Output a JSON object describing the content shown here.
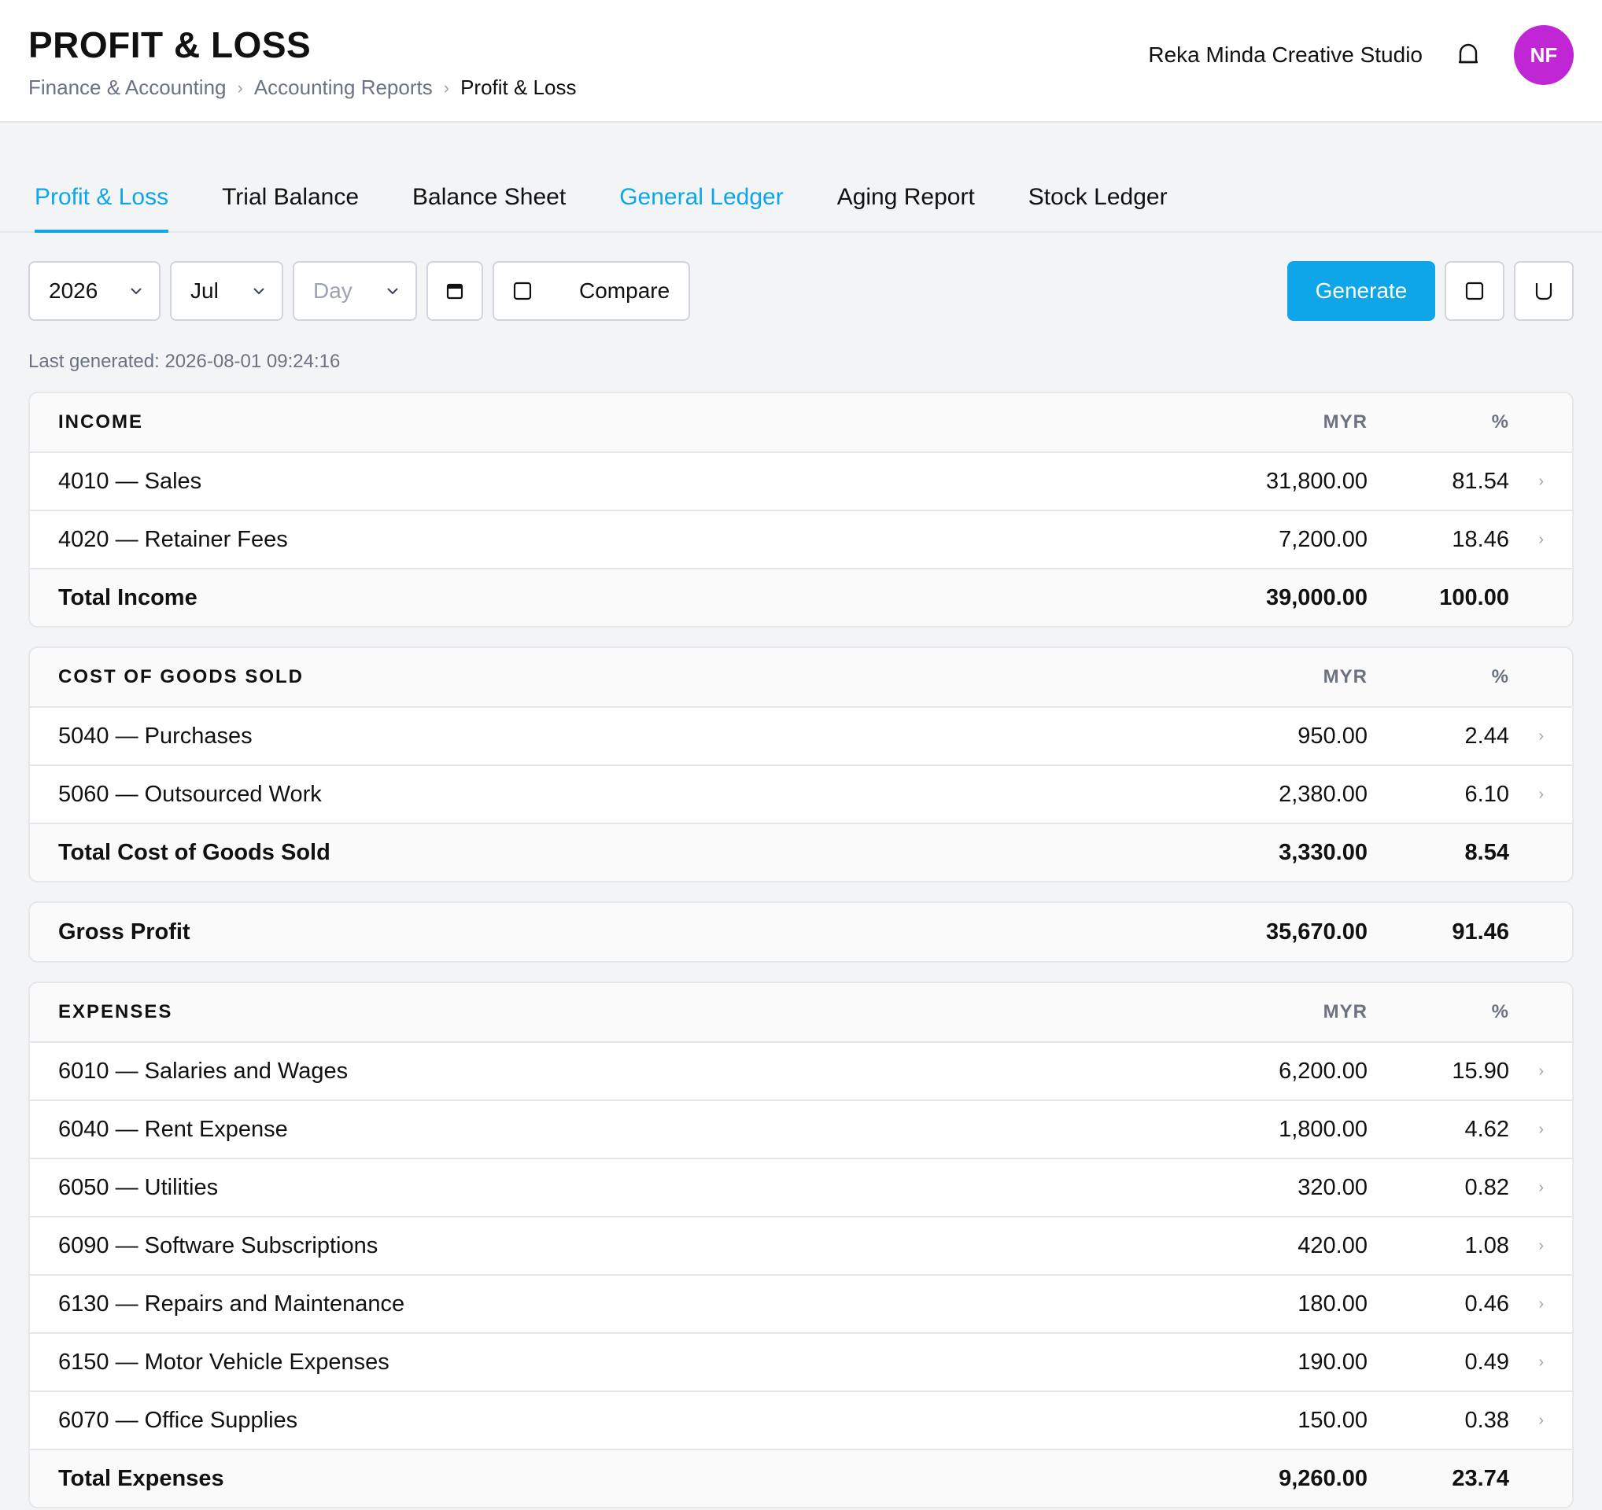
{
  "header": {
    "title": "PROFIT & LOSS",
    "breadcrumb": [
      "Finance & Accounting",
      "Accounting Reports",
      "Profit & Loss"
    ],
    "org_name": "Reka Minda Creative Studio",
    "avatar_initials": "NF",
    "bell_icon": "bell-icon"
  },
  "tabs": [
    "Profit & Loss",
    "Trial Balance",
    "Balance Sheet",
    "General Ledger",
    "Aging Report",
    "Stock Ledger"
  ],
  "toolbar": {
    "year": "2026",
    "month": "Jul",
    "day_placeholder": "Day",
    "calendar_icon": "calendar-icon",
    "compare_label": "Compare",
    "generate_label": "Generate",
    "print_icon": "print-icon",
    "download_icon": "download-icon"
  },
  "last_generated": "Last generated: 2026-08-01 09:24:16",
  "colors": {
    "accent": "#0ea5e9",
    "avatar": "#c026d3"
  },
  "income": {
    "heading": "INCOME",
    "col_amount": "MYR",
    "col_pct": "%",
    "rows": [
      {
        "name": "4010 — Sales",
        "amount": "31,800.00",
        "pct": "81.54"
      },
      {
        "name": "4020 — Retainer Fees",
        "amount": "7,200.00",
        "pct": "18.46"
      }
    ],
    "total": {
      "name": "Total Income",
      "amount": "39,000.00",
      "pct": "100.00"
    }
  },
  "cogs": {
    "heading": "COST OF GOODS SOLD",
    "col_amount": "MYR",
    "col_pct": "%",
    "rows": [
      {
        "name": "5040 — Purchases",
        "amount": "950.00",
        "pct": "2.44"
      },
      {
        "name": "5060 — Outsourced Work",
        "amount": "2,380.00",
        "pct": "6.10"
      }
    ],
    "total": {
      "name": "Total Cost of Goods Sold",
      "amount": "3,330.00",
      "pct": "8.54"
    }
  },
  "gross": {
    "name": "Gross Profit",
    "amount": "35,670.00",
    "pct": "91.46"
  },
  "expenses": {
    "heading": "EXPENSES",
    "col_amount": "MYR",
    "col_pct": "%",
    "rows": [
      {
        "name": "6010 — Salaries and Wages",
        "amount": "6,200.00",
        "pct": "15.90"
      },
      {
        "name": "6040 — Rent Expense",
        "amount": "1,800.00",
        "pct": "4.62"
      },
      {
        "name": "6050 — Utilities",
        "amount": "320.00",
        "pct": "0.82"
      },
      {
        "name": "6090 — Software Subscriptions",
        "amount": "420.00",
        "pct": "1.08"
      },
      {
        "name": "6130 — Repairs and Maintenance",
        "amount": "180.00",
        "pct": "0.46"
      },
      {
        "name": "6150 — Motor Vehicle Expenses",
        "amount": "190.00",
        "pct": "0.49"
      },
      {
        "name": "6070 — Office Supplies",
        "amount": "150.00",
        "pct": "0.38"
      }
    ],
    "total": {
      "name": "Total Expenses",
      "amount": "9,260.00",
      "pct": "23.74"
    }
  }
}
